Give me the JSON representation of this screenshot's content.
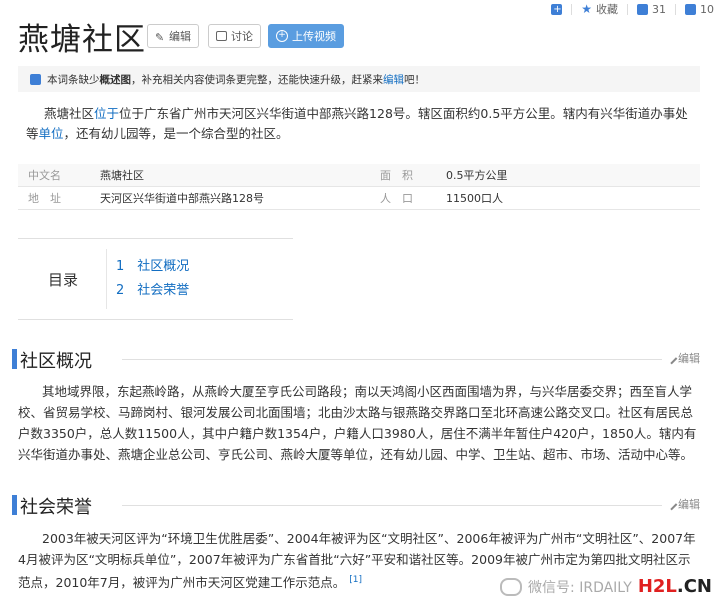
{
  "topbar": {
    "fav_label": "收藏",
    "like_count": "31",
    "share_count": "10"
  },
  "title": "燕塘社区",
  "actions": {
    "edit": "编辑",
    "discuss": "讨论",
    "upload": "上传视频"
  },
  "notice": {
    "text1": "本词条缺少",
    "highlight": "概述图",
    "text2": "，补充相关内容使词条更完整，还能快速升级，赶紧来",
    "link": "编辑",
    "text3": "吧！"
  },
  "summary": {
    "p1": "燕塘社区",
    "link1": "位于",
    "p2": "位于广东省广州市天河区兴华街道中部燕兴路128号。辖区面积约0.5平方公里。辖内有兴华街道办事处等",
    "link2": "单位",
    "p3": "，还有幼儿园等，是一个综合型的社区。"
  },
  "infobox": {
    "r1": {
      "k1": "中文名",
      "v1": "燕塘社区",
      "k2": "面　积",
      "v2": "0.5平方公里"
    },
    "r2": {
      "k1": "地　址",
      "v1": "天河区兴华街道中部燕兴路128号",
      "k2": "人　口",
      "v2": "11500口人"
    }
  },
  "toc": {
    "label": "目录",
    "items": [
      "1　社区概况",
      "2　社会荣誉"
    ]
  },
  "sections": {
    "s1": {
      "title": "社区概况",
      "edit": "编辑",
      "body": "其地域界限，东起燕岭路，从燕岭大厦至亨氏公司路段；南以天鸿阁小区西面围墙为界，与兴华居委交界；西至盲人学校、省贸易学校、马蹄岗村、银河发展公司北面围墙；北由沙太路与银燕路交界路口至北环高速公路交叉口。社区有居民总户数3350户，总人数11500人，其中户籍户数1354户，户籍人口3980人，居住不满半年暂住户420户，1850人。辖内有兴华街道办事处、燕塘企业总公司、亨氏公司、燕岭大厦等单位，还有幼儿园、中学、卫生站、超市、市场、活动中心等。"
    },
    "s2": {
      "title": "社会荣誉",
      "edit": "编辑",
      "body": "2003年被天河区评为“环境卫生优胜居委”、2004年被评为区“文明社区”、2006年被评为广州市“文明社区”、2007年4月被评为区“文明标兵单位”，2007年被评为广东省首批“六好”平安和谐社区等。2009年被广州市定为第四批文明社区示范点，2010年7月，被评为广州市天河区党建工作示范点。",
      "ref": "[1]"
    }
  },
  "watermark": {
    "text": "微信号: IRDAILY",
    "logo_a": "H2L",
    "logo_b": ".CN"
  }
}
